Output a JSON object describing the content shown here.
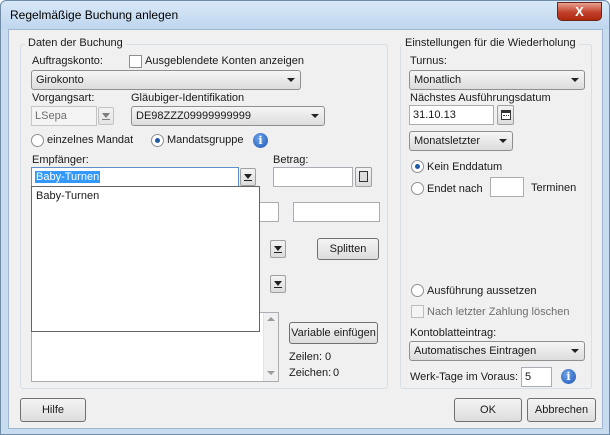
{
  "window": {
    "title": "Regelmäßige Buchung anlegen",
    "close_symbol": "X"
  },
  "left_group": {
    "title": "Daten der Buchung",
    "auftragskonto_label": "Auftragskonto:",
    "show_hidden_label": "Ausgeblendete Konten anzeigen",
    "auftragskonto_value": "Girokonto",
    "vorgangsart_label": "Vorgangsart:",
    "vorgangsart_value": "LSepa",
    "glaeubiger_label": "Gläubiger-Identifikation",
    "glaeubiger_value": "DE98ZZZ09999999999",
    "radio_single": "einzelnes Mandat",
    "radio_group": "Mandatsgruppe",
    "empfaenger_label": "Empfänger:",
    "empfaenger_value": "Baby-Turnen",
    "betrag_label": "Betrag:",
    "dropdown_items": [
      "Baby-Turnen"
    ],
    "splitten_label": "Splitten",
    "variable_label": "Variable einfügen",
    "zeilen_label": "Zeilen:",
    "zeilen_value": "0",
    "zeichen_label": "Zeichen:",
    "zeichen_value": "0"
  },
  "right_group": {
    "title": "Einstellungen für die Wiederholung",
    "turnus_label": "Turnus:",
    "turnus_value": "Monatlich",
    "next_date_label": "Nächstes Ausführungsdatum",
    "next_date_value": "31.10.13",
    "monats_value": "Monatsletzter",
    "kein_enddatum": "Kein Enddatum",
    "endet_nach": "Endet nach",
    "termine": "Terminen",
    "aussetzen": "Ausführung aussetzen",
    "loeschen": "Nach letzter Zahlung löschen",
    "kontoblatt_label": "Kontoblatteintrag:",
    "kontoblatt_value": "Automatisches Eintragen",
    "werktage_label": "Werk-Tage im Voraus:",
    "werktage_value": "5"
  },
  "footer": {
    "help": "Hilfe",
    "ok": "OK",
    "cancel": "Abbrechen"
  },
  "icons": {
    "info": "info-icon",
    "calendar": "calendar-icon",
    "calculator": "calculator-icon"
  },
  "colors": {
    "selection": "#3399ff",
    "radio_dot": "#1f5aa8",
    "info_blue": "#1b55b8"
  }
}
